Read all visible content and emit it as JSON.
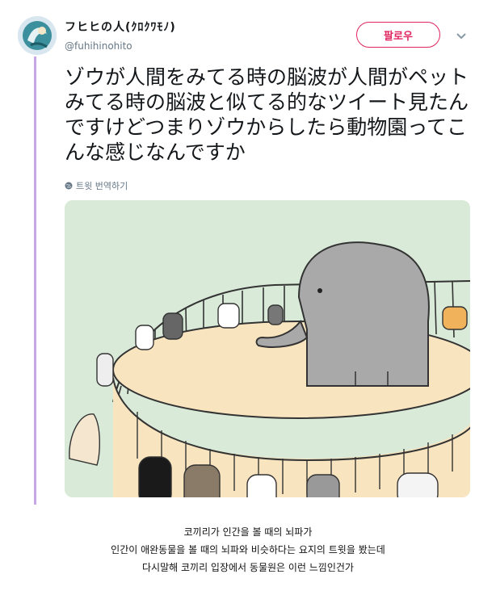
{
  "author": {
    "name": "フヒヒの人(ｸﾛｸﾜﾓﾉ)",
    "handle": "@fuhihinohito"
  },
  "follow_button": {
    "label": "팔로우"
  },
  "tweet": {
    "text": "ゾウが人間をみてる時の脳波が人間がペットみてる時の脳波と似てる的なツイート見たんですけどつまりゾウからしたら動物園ってこんな感じなんですか",
    "translate_label": "트윗 번역하기"
  },
  "caption": {
    "line1": "코끼리가 인간을 볼 때의 뇌파가",
    "line2": "인간이 애완동물을 볼 때의 뇌파와 비슷하다는 요지의 트윗을 봤는데",
    "line3": "다시말해 코끼리 입장에서 동물원은 이런 느낌인건가"
  },
  "colors": {
    "accent": "#e0245e",
    "thread_line": "#c7a6e6",
    "image_bg": "#d9ead8",
    "elephant": "#a9a9a9",
    "floor": "#f8e4bf"
  }
}
